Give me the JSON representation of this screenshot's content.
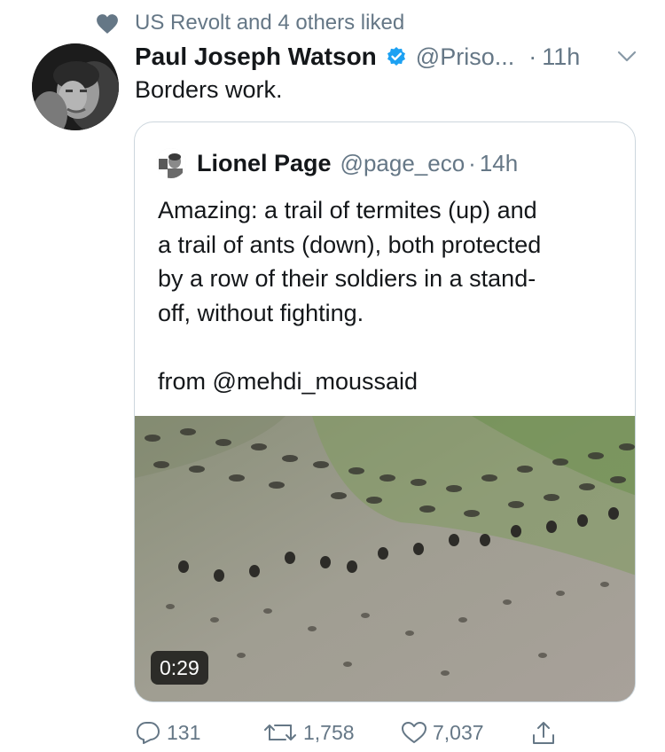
{
  "social_context": {
    "icon": "heart-icon",
    "text": "US Revolt and 4 others liked"
  },
  "tweet": {
    "author_name": "Paul Joseph Watson",
    "verified_icon": "verified-badge-icon",
    "handle": "@Priso...",
    "separator": "·",
    "time": "11h",
    "text": "Borders work."
  },
  "quoted_tweet": {
    "author_name": "Lionel Page",
    "handle": "@page_eco",
    "separator": "·",
    "time": "14h",
    "text_lines": [
      "Amazing: a trail of termites (up) and",
      "a trail of ants (down), both protected",
      "by a row of their soldiers in a stand-",
      "off, without fighting.",
      "",
      "from @mehdi_moussaid"
    ],
    "video_duration": "0:29"
  },
  "actions": {
    "reply_count": "131",
    "retweet_count": "1,758",
    "like_count": "7,037"
  },
  "colors": {
    "text_primary": "#14171a",
    "text_secondary": "#657786",
    "verified_blue": "#1da1f2",
    "border": "#ccd6dd"
  }
}
